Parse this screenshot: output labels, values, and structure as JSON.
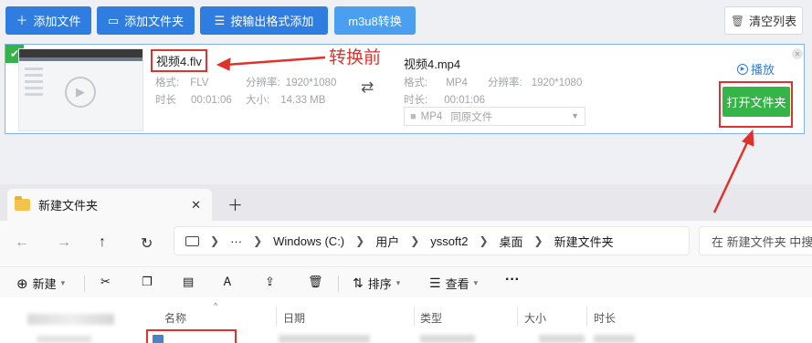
{
  "toolbar": {
    "add_file": "添加文件",
    "add_folder": "添加文件夹",
    "add_by_format": "按输出格式添加",
    "m3u8": "m3u8转换",
    "clear_list": "清空列表"
  },
  "source": {
    "name": "视频4.flv",
    "format_label": "格式:",
    "format": "FLV",
    "resolution_label": "分辨率:",
    "resolution": "1920*1080",
    "duration_label": "时长",
    "duration": "00:01:06",
    "size_label": "大小:",
    "size": "14.33 MB"
  },
  "annotation": {
    "before": "转换前"
  },
  "target": {
    "name": "视频4.mp4",
    "format_label": "格式:",
    "format": "MP4",
    "resolution_label": "分辨率:",
    "resolution": "1920*1080",
    "duration_label": "时长:",
    "duration": "00:01:06",
    "select_format": "MP4",
    "select_quality": "同原文件"
  },
  "actions": {
    "play": "播放",
    "open_folder": "打开文件夹"
  },
  "explorer": {
    "tab_title": "新建文件夹",
    "breadcrumb": [
      "Windows (C:)",
      "用户",
      "yssoft2",
      "桌面",
      "新建文件夹"
    ],
    "breadcrumb_more": "···",
    "search_placeholder": "在 新建文件夹 中搜",
    "commands": {
      "new": "新建",
      "sort": "排序",
      "view": "查看",
      "more": "···"
    },
    "columns": [
      "名称",
      "日期",
      "类型",
      "大小",
      "时长"
    ]
  },
  "colors": {
    "primary_blue": "#2f7de0",
    "green": "#35b447",
    "annotation_red": "#e0322c"
  }
}
